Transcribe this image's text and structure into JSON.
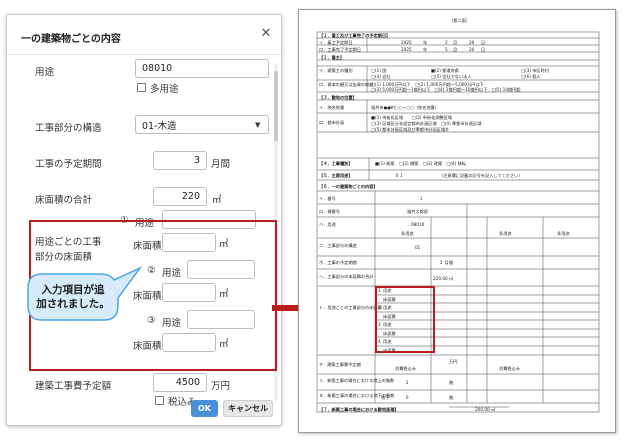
{
  "dialog": {
    "title": "一の建築物ごとの内容",
    "close_glyph": "✕",
    "purpose": {
      "label": "用途",
      "value": "08010",
      "multi_label": "多用途"
    },
    "structure": {
      "label": "工事部分の構造",
      "value": "01-木造"
    },
    "period": {
      "label": "工事の予定期間",
      "value": "3",
      "unit": "月間"
    },
    "floor_total": {
      "label": "床面積の合計",
      "value": "220",
      "unit": "㎡"
    },
    "per_use": {
      "label_line1": "用途ごとの工事",
      "label_line2": "部分の床面積",
      "rows": [
        {
          "num": "①",
          "purpose_label": "用途",
          "area_label": "床面積",
          "area_unit": "㎡"
        },
        {
          "num": "②",
          "purpose_label": "用途",
          "area_label": "床面積",
          "area_unit": "㎡"
        },
        {
          "num": "③",
          "purpose_label": "用途",
          "area_label": "床面積",
          "area_unit": "㎡"
        }
      ]
    },
    "cost": {
      "label": "建築工事費予定額",
      "value": "4500",
      "unit": "万円",
      "tax_label": "税込み"
    },
    "ok_label": "OK",
    "cancel_label": "キャンセル"
  },
  "callout": {
    "line1": "入力項目が追",
    "line2": "加されました。"
  },
  "accent_colors": {
    "highlight_red": "#b81e1e",
    "bubble_fill": "#d6ecfa",
    "bubble_stroke": "#4da6e6",
    "ok_button": "#4a90d9"
  },
  "document": {
    "page_label": "（第二面）",
    "sections": {
      "s1": "【１．着工及び工事完了の予定期日】",
      "s2": "【２．着主】",
      "s3": "【３．敷地の位置】",
      "s4": "【４．工事種別】",
      "s5": "【５．主要用途】",
      "s6": "【６．一の建築物ごとの内容】",
      "s7": "【７．新築工事の場合における敷地面積】"
    },
    "s1_rows": [
      {
        "label": "イ．着工予定期日",
        "year": "2025",
        "y": "年",
        "month": "2",
        "m": "月",
        "day": "20",
        "d": "日"
      },
      {
        "label": "ロ．工事完了予定期日",
        "year": "2025",
        "y": "年",
        "month": "5",
        "m": "月",
        "day": "20",
        "d": "日"
      }
    ],
    "s2_labels": [
      "イ．建築主の種別",
      "ロ．資本の額又は出資の総額"
    ],
    "s2_opts_row1": [
      "□(1) 国",
      "■(2) 都道府県",
      "□(3) 市区町村"
    ],
    "s2_opts_row2": [
      "□(4) 会社",
      "□(5) 会社でない法人",
      "□(6) 個人"
    ],
    "s2_capital_1": "□(1) 1,000万円以下　□(2) 1,000万円超～5,000万円以下",
    "s2_capital_2": "□(3) 5,000万円超～1億円以下　□(4) 1億円超～10億円以下　□(5) 10億円超",
    "s3_labels": [
      "イ．地名地番",
      "ロ．都市計画"
    ],
    "s3_address": "福井市●●町○○ー○○（地名地番）",
    "s3_plan_1": "■(1) 市街化区域　　□(2) 市街化調整区域",
    "s3_plan_2": "□(3) 区域区分非設定都市計画区域　□(4) 準都市計画区域",
    "s3_plan_3": "□(5) 都市計画区域及び準都市計画区域外",
    "s4_label": "【４．工事種別】",
    "s4_value": "■(1) 新築　□(2) 増築　□(3) 改築　□(4) 移転",
    "s5_value": "０１",
    "s5_note": "（注意欄に記載の記号を記入してください）",
    "s6_rows": [
      "イ．番号",
      "ロ．棟番号",
      "ハ．用途",
      "ニ．工事部分の構造",
      "ホ．工事の予定期間",
      "ヘ．工事部分の床面積の合計",
      "ト．用途ごとの工事部分の床面積",
      "チ．建築工事費予定額",
      "リ．新築工事の場合における地上の階数",
      "ヌ．新築工事の場合における地下の階数"
    ],
    "s6_num_value": "１",
    "s6_name_value": "福井太郎邸",
    "s6_use_value": "08010",
    "s6_struct_value": "01",
    "s6_period_value": "３ 月間",
    "s6_area_value": "220.00 ㎡",
    "s6_multi": "多用途",
    "s6_use_sub": "用途",
    "s6_area_sub": "床面積",
    "s6_cost_unit": "万円",
    "s6_tax": "消費税込み",
    "s6_floor": "階",
    "s6_above_value": "２",
    "s6_below": "地下",
    "s6_below_value": "０",
    "s6_nums": [
      "1",
      "2",
      "3",
      "4"
    ],
    "s7_value": "200.00 ㎡"
  }
}
